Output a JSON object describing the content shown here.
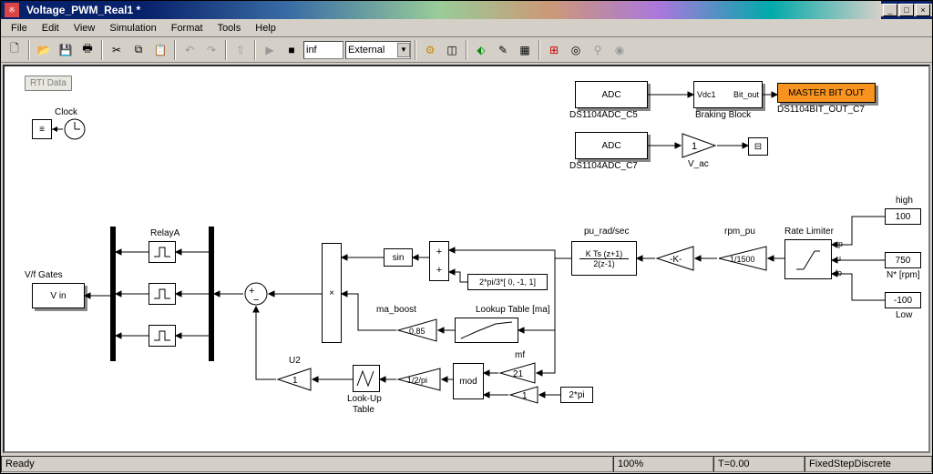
{
  "window": {
    "title": "Voltage_PWM_Real1 *"
  },
  "menu": {
    "file": "File",
    "edit": "Edit",
    "view": "View",
    "sim": "Simulation",
    "format": "Format",
    "tools": "Tools",
    "help": "Help"
  },
  "toolbar": {
    "stoptime": "inf",
    "mode": "External"
  },
  "status": {
    "ready": "Ready",
    "pct": "100%",
    "t": "T=0.00",
    "solver": "FixedStepDiscrete"
  },
  "blocks": {
    "rti": "RTI Data",
    "clock": "Clock",
    "adc1": "ADC",
    "adc1_sub": "DS1104ADC_C5",
    "adc2": "ADC",
    "adc2_sub": "DS1104ADC_C7",
    "brake_in": "Vdc1",
    "brake_out": "Bit_out",
    "brake_sub": "Braking Block",
    "master": "MASTER BIT OUT",
    "master_sub": "DS1104BIT_OUT_C7",
    "gain_vac": "1",
    "vac_lbl": "V_ac",
    "vf": "V/f Gates",
    "vin": "V in",
    "relayA": "RelayA",
    "sin": "sin",
    "phase": "2*pi/3*[ 0, -1, 1]",
    "pu": "K Ts (z+1)",
    "pu_den": "2(z-1)",
    "pu_lbl": "pu_rad/sec",
    "kgain": "-K-",
    "rpm": "1/1500",
    "rpm_lbl": "rpm_pu",
    "rate": "Rate Limiter",
    "rate_up": "up",
    "rate_u": "u",
    "rate_lo": "lo",
    "high": "high",
    "high_v": "100",
    "nrpm": "750",
    "nrpm_lbl": "N* [rpm]",
    "low": "-100",
    "low_lbl": "Low",
    "ma_boost": "ma_boost",
    "ma_g": "0.85",
    "lookup_ma": "Lookup Table [ma]",
    "u2": "U2",
    "u2_g": "1",
    "lut": "Look-Up",
    "lut2": "Table",
    "inv2pi": "1/2/pi",
    "mod": "mod",
    "mf": "mf",
    "mf_g": "21",
    "c1": "1",
    "twopi": "2*pi"
  }
}
